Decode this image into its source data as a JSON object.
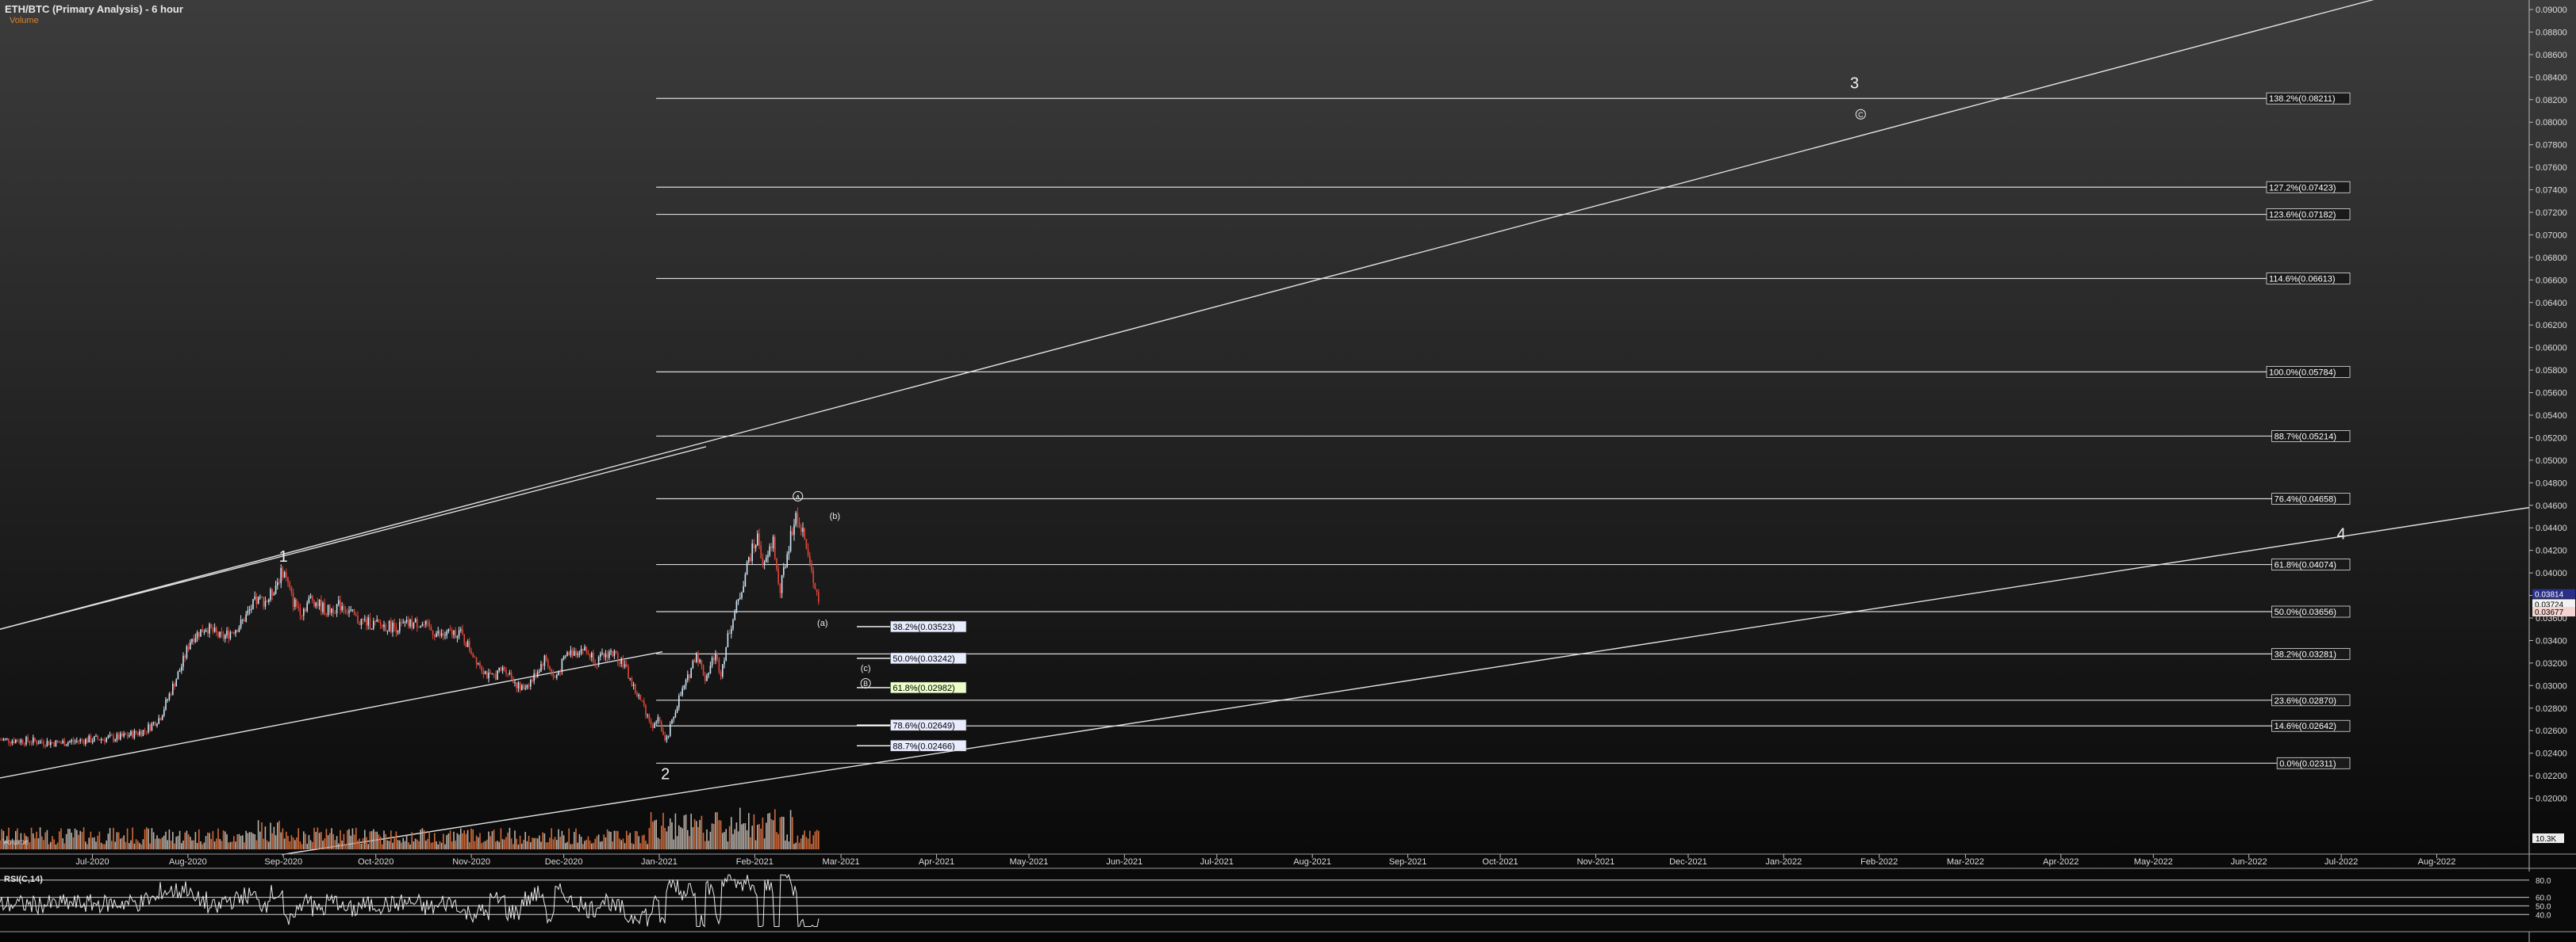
{
  "header": {
    "title": "ETH/BTC (Primary Analysis) - 6 hour",
    "subtitle": "Volume"
  },
  "colors": {
    "background_top": "#3a3a3a",
    "background_bottom": "#050505",
    "up_candle": "#cfe3f2",
    "down_candle": "#e0463a",
    "volume_up": "#b8b0a8",
    "volume_down": "#d06a3a",
    "line": "#e6e6e6",
    "fib_label_bg": "#ffffff",
    "fib_highlight_bg": "#eaffc8",
    "price_tag_bg": "#2a2f8a"
  },
  "volume": {
    "label": "Volume",
    "last_value": "10.3K"
  },
  "rsi": {
    "label": "RSI(C,14)",
    "ticks": [
      "80.0",
      "60.0",
      "50.0",
      "40.0"
    ]
  },
  "chart_data": {
    "type": "line",
    "symbol": "ETH/BTC",
    "interval": "6 hour",
    "y_axis": {
      "min": 0.018,
      "max": 0.09,
      "ticks": [
        "0.09000",
        "0.08800",
        "0.08600",
        "0.08400",
        "0.08200",
        "0.08000",
        "0.07800",
        "0.07600",
        "0.07400",
        "0.07200",
        "0.07000",
        "0.06800",
        "0.06600",
        "0.06400",
        "0.06200",
        "0.06000",
        "0.05800",
        "0.05600",
        "0.05400",
        "0.05200",
        "0.05000",
        "0.04800",
        "0.04600",
        "0.04400",
        "0.04200",
        "0.04000",
        "0.03800",
        "0.03600",
        "0.03400",
        "0.03200",
        "0.03000",
        "0.02800",
        "0.02600",
        "0.02400",
        "0.02200",
        "0.02000"
      ]
    },
    "x_axis": {
      "start": "2020-06-01",
      "end": "2022-08-31",
      "ticks": [
        "Jul-2020",
        "Aug-2020",
        "Sep-2020",
        "Oct-2020",
        "Nov-2020",
        "Dec-2020",
        "Jan-2021",
        "Feb-2021",
        "Mar-2021",
        "Apr-2021",
        "May-2021",
        "Jun-2021",
        "Jul-2021",
        "Aug-2021",
        "Sep-2021",
        "Oct-2021",
        "Nov-2021",
        "Dec-2021",
        "Jan-2022",
        "Feb-2022",
        "Mar-2022",
        "Apr-2022",
        "May-2022",
        "Jun-2022",
        "Jul-2022",
        "Aug-2022"
      ]
    },
    "price_path": [
      [
        "2020-06-01",
        0.0252
      ],
      [
        "2020-06-10",
        0.0251
      ],
      [
        "2020-06-20",
        0.0249
      ],
      [
        "2020-06-30",
        0.0252
      ],
      [
        "2020-07-10",
        0.0254
      ],
      [
        "2020-07-18",
        0.026
      ],
      [
        "2020-07-23",
        0.0272
      ],
      [
        "2020-07-26",
        0.0292
      ],
      [
        "2020-07-30",
        0.0318
      ],
      [
        "2020-08-02",
        0.0342
      ],
      [
        "2020-08-07",
        0.0352
      ],
      [
        "2020-08-12",
        0.0342
      ],
      [
        "2020-08-18",
        0.0354
      ],
      [
        "2020-08-23",
        0.0375
      ],
      [
        "2020-08-27",
        0.0376
      ],
      [
        "2020-09-01",
        0.0403
      ],
      [
        "2020-09-04",
        0.0375
      ],
      [
        "2020-09-07",
        0.0366
      ],
      [
        "2020-09-10",
        0.0378
      ],
      [
        "2020-09-15",
        0.0366
      ],
      [
        "2020-09-20",
        0.0372
      ],
      [
        "2020-09-25",
        0.0358
      ],
      [
        "2020-10-01",
        0.0354
      ],
      [
        "2020-10-08",
        0.0352
      ],
      [
        "2020-10-15",
        0.0356
      ],
      [
        "2020-10-22",
        0.0344
      ],
      [
        "2020-10-28",
        0.0348
      ],
      [
        "2020-11-03",
        0.0322
      ],
      [
        "2020-11-07",
        0.0306
      ],
      [
        "2020-11-12",
        0.0316
      ],
      [
        "2020-11-17",
        0.0296
      ],
      [
        "2020-11-21",
        0.0306
      ],
      [
        "2020-11-25",
        0.0325
      ],
      [
        "2020-11-28",
        0.0305
      ],
      [
        "2020-12-02",
        0.0328
      ],
      [
        "2020-12-07",
        0.0333
      ],
      [
        "2020-12-12",
        0.0322
      ],
      [
        "2020-12-16",
        0.033
      ],
      [
        "2020-12-20",
        0.0322
      ],
      [
        "2020-12-24",
        0.0296
      ],
      [
        "2020-12-28",
        0.0276
      ],
      [
        "2020-12-30",
        0.0262
      ],
      [
        "2021-01-01",
        0.027
      ],
      [
        "2021-01-03",
        0.0248
      ],
      [
        "2021-01-05",
        0.0266
      ],
      [
        "2021-01-07",
        0.0286
      ],
      [
        "2021-01-10",
        0.0304
      ],
      [
        "2021-01-13",
        0.033
      ],
      [
        "2021-01-16",
        0.0306
      ],
      [
        "2021-01-19",
        0.0328
      ],
      [
        "2021-01-21",
        0.0312
      ],
      [
        "2021-01-24",
        0.0352
      ],
      [
        "2021-01-27",
        0.0378
      ],
      [
        "2021-01-30",
        0.0412
      ],
      [
        "2021-02-02",
        0.0432
      ],
      [
        "2021-02-04",
        0.0404
      ],
      [
        "2021-02-07",
        0.043
      ],
      [
        "2021-02-09",
        0.038
      ],
      [
        "2021-02-11",
        0.041
      ],
      [
        "2021-02-13",
        0.0438
      ],
      [
        "2021-02-15",
        0.0452
      ],
      [
        "2021-02-17",
        0.0432
      ],
      [
        "2021-02-19",
        0.0404
      ],
      [
        "2021-02-21",
        0.0385
      ],
      [
        "2021-02-22",
        0.0374
      ]
    ],
    "current_price_tags": [
      "0.03814",
      "0.03724",
      "0.03677"
    ],
    "fib_right": [
      {
        "label": "138.2%(0.08211)",
        "value": 0.08211
      },
      {
        "label": "127.2%(0.07423)",
        "value": 0.07423
      },
      {
        "label": "123.6%(0.07182)",
        "value": 0.07182
      },
      {
        "label": "114.6%(0.06613)",
        "value": 0.06613
      },
      {
        "label": "100.0%(0.05784)",
        "value": 0.05784
      },
      {
        "label": "88.7%(0.05214)",
        "value": 0.05214
      },
      {
        "label": "76.4%(0.04658)",
        "value": 0.04658
      },
      {
        "label": "61.8%(0.04074)",
        "value": 0.04074
      },
      {
        "label": "50.0%(0.03656)",
        "value": 0.03656
      },
      {
        "label": "38.2%(0.03281)",
        "value": 0.03281
      },
      {
        "label": "23.6%(0.02870)",
        "value": 0.0287
      },
      {
        "label": "14.6%(0.02642)",
        "value": 0.02642
      },
      {
        "label": "0.0%(0.02311)",
        "value": 0.02311
      }
    ],
    "fib_left": [
      {
        "label": "38.2%(0.03523)",
        "value": 0.03523,
        "highlight": false
      },
      {
        "label": "50.0%(0.03242)",
        "value": 0.03242,
        "highlight": false
      },
      {
        "label": "61.8%(0.02982)",
        "value": 0.02982,
        "highlight": true
      },
      {
        "label": "78.6%(0.02649)",
        "value": 0.02649,
        "highlight": false
      },
      {
        "label": "88.7%(0.02466)",
        "value": 0.02466,
        "highlight": false
      }
    ],
    "wave_labels": [
      {
        "text": "1",
        "date": "2020-09-01",
        "value": 0.041,
        "style": "plain"
      },
      {
        "text": "2",
        "date": "2021-01-03",
        "value": 0.0217,
        "style": "plain"
      },
      {
        "text": "3",
        "date": "2022-01-24",
        "value": 0.083,
        "style": "plain"
      },
      {
        "text": "4",
        "date": "2022-07-01",
        "value": 0.043,
        "style": "plain"
      },
      {
        "text": "∧",
        "date": "2021-02-15",
        "value": 0.0468,
        "style": "circle"
      },
      {
        "text": "(b)",
        "date": "2021-02-27",
        "value": 0.0448,
        "style": "small"
      },
      {
        "text": "(a)",
        "date": "2021-02-23",
        "value": 0.0353,
        "style": "small"
      },
      {
        "text": "(c)",
        "date": "2021-03-09",
        "value": 0.0313,
        "style": "small"
      },
      {
        "text": "B",
        "date": "2021-03-09",
        "value": 0.0302,
        "style": "circle"
      },
      {
        "text": "C",
        "date": "2022-01-26",
        "value": 0.0807,
        "style": "circle"
      }
    ]
  }
}
